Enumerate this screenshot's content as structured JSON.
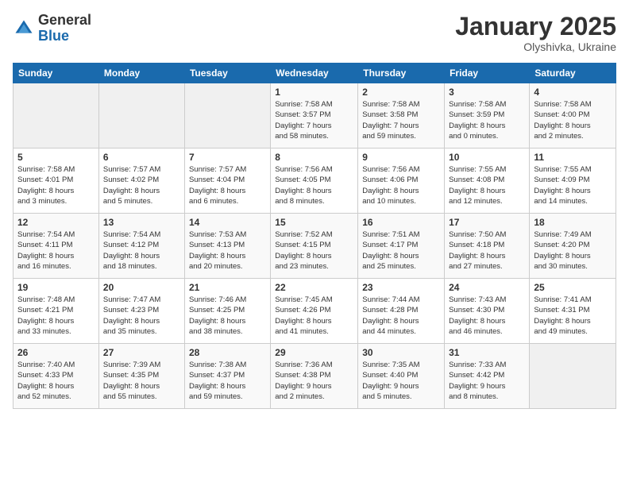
{
  "logo": {
    "general": "General",
    "blue": "Blue"
  },
  "header": {
    "title": "January 2025",
    "subtitle": "Olyshivka, Ukraine"
  },
  "weekdays": [
    "Sunday",
    "Monday",
    "Tuesday",
    "Wednesday",
    "Thursday",
    "Friday",
    "Saturday"
  ],
  "weeks": [
    [
      {
        "day": "",
        "info": ""
      },
      {
        "day": "",
        "info": ""
      },
      {
        "day": "",
        "info": ""
      },
      {
        "day": "1",
        "info": "Sunrise: 7:58 AM\nSunset: 3:57 PM\nDaylight: 7 hours\nand 58 minutes."
      },
      {
        "day": "2",
        "info": "Sunrise: 7:58 AM\nSunset: 3:58 PM\nDaylight: 7 hours\nand 59 minutes."
      },
      {
        "day": "3",
        "info": "Sunrise: 7:58 AM\nSunset: 3:59 PM\nDaylight: 8 hours\nand 0 minutes."
      },
      {
        "day": "4",
        "info": "Sunrise: 7:58 AM\nSunset: 4:00 PM\nDaylight: 8 hours\nand 2 minutes."
      }
    ],
    [
      {
        "day": "5",
        "info": "Sunrise: 7:58 AM\nSunset: 4:01 PM\nDaylight: 8 hours\nand 3 minutes."
      },
      {
        "day": "6",
        "info": "Sunrise: 7:57 AM\nSunset: 4:02 PM\nDaylight: 8 hours\nand 5 minutes."
      },
      {
        "day": "7",
        "info": "Sunrise: 7:57 AM\nSunset: 4:04 PM\nDaylight: 8 hours\nand 6 minutes."
      },
      {
        "day": "8",
        "info": "Sunrise: 7:56 AM\nSunset: 4:05 PM\nDaylight: 8 hours\nand 8 minutes."
      },
      {
        "day": "9",
        "info": "Sunrise: 7:56 AM\nSunset: 4:06 PM\nDaylight: 8 hours\nand 10 minutes."
      },
      {
        "day": "10",
        "info": "Sunrise: 7:55 AM\nSunset: 4:08 PM\nDaylight: 8 hours\nand 12 minutes."
      },
      {
        "day": "11",
        "info": "Sunrise: 7:55 AM\nSunset: 4:09 PM\nDaylight: 8 hours\nand 14 minutes."
      }
    ],
    [
      {
        "day": "12",
        "info": "Sunrise: 7:54 AM\nSunset: 4:11 PM\nDaylight: 8 hours\nand 16 minutes."
      },
      {
        "day": "13",
        "info": "Sunrise: 7:54 AM\nSunset: 4:12 PM\nDaylight: 8 hours\nand 18 minutes."
      },
      {
        "day": "14",
        "info": "Sunrise: 7:53 AM\nSunset: 4:13 PM\nDaylight: 8 hours\nand 20 minutes."
      },
      {
        "day": "15",
        "info": "Sunrise: 7:52 AM\nSunset: 4:15 PM\nDaylight: 8 hours\nand 23 minutes."
      },
      {
        "day": "16",
        "info": "Sunrise: 7:51 AM\nSunset: 4:17 PM\nDaylight: 8 hours\nand 25 minutes."
      },
      {
        "day": "17",
        "info": "Sunrise: 7:50 AM\nSunset: 4:18 PM\nDaylight: 8 hours\nand 27 minutes."
      },
      {
        "day": "18",
        "info": "Sunrise: 7:49 AM\nSunset: 4:20 PM\nDaylight: 8 hours\nand 30 minutes."
      }
    ],
    [
      {
        "day": "19",
        "info": "Sunrise: 7:48 AM\nSunset: 4:21 PM\nDaylight: 8 hours\nand 33 minutes."
      },
      {
        "day": "20",
        "info": "Sunrise: 7:47 AM\nSunset: 4:23 PM\nDaylight: 8 hours\nand 35 minutes."
      },
      {
        "day": "21",
        "info": "Sunrise: 7:46 AM\nSunset: 4:25 PM\nDaylight: 8 hours\nand 38 minutes."
      },
      {
        "day": "22",
        "info": "Sunrise: 7:45 AM\nSunset: 4:26 PM\nDaylight: 8 hours\nand 41 minutes."
      },
      {
        "day": "23",
        "info": "Sunrise: 7:44 AM\nSunset: 4:28 PM\nDaylight: 8 hours\nand 44 minutes."
      },
      {
        "day": "24",
        "info": "Sunrise: 7:43 AM\nSunset: 4:30 PM\nDaylight: 8 hours\nand 46 minutes."
      },
      {
        "day": "25",
        "info": "Sunrise: 7:41 AM\nSunset: 4:31 PM\nDaylight: 8 hours\nand 49 minutes."
      }
    ],
    [
      {
        "day": "26",
        "info": "Sunrise: 7:40 AM\nSunset: 4:33 PM\nDaylight: 8 hours\nand 52 minutes."
      },
      {
        "day": "27",
        "info": "Sunrise: 7:39 AM\nSunset: 4:35 PM\nDaylight: 8 hours\nand 55 minutes."
      },
      {
        "day": "28",
        "info": "Sunrise: 7:38 AM\nSunset: 4:37 PM\nDaylight: 8 hours\nand 59 minutes."
      },
      {
        "day": "29",
        "info": "Sunrise: 7:36 AM\nSunset: 4:38 PM\nDaylight: 9 hours\nand 2 minutes."
      },
      {
        "day": "30",
        "info": "Sunrise: 7:35 AM\nSunset: 4:40 PM\nDaylight: 9 hours\nand 5 minutes."
      },
      {
        "day": "31",
        "info": "Sunrise: 7:33 AM\nSunset: 4:42 PM\nDaylight: 9 hours\nand 8 minutes."
      },
      {
        "day": "",
        "info": ""
      }
    ]
  ]
}
